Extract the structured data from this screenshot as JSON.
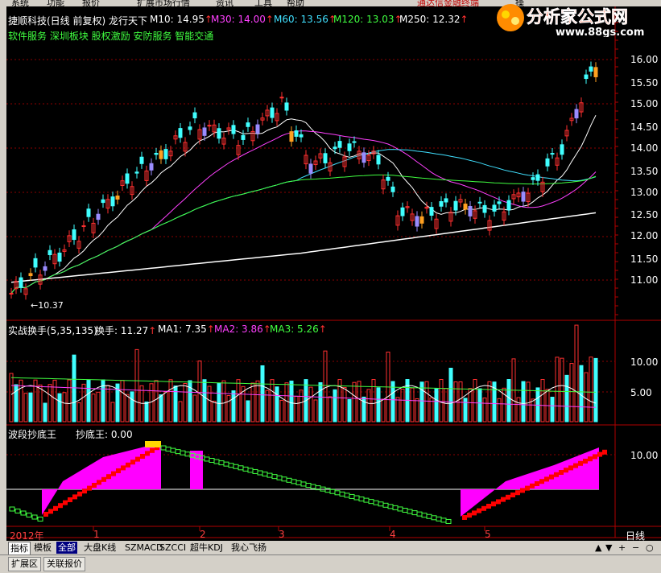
{
  "menu": [
    "系统",
    "功能",
    "报价",
    "扩展市场行情",
    "资讯",
    "工具",
    "帮助",
    "通达信金融终端",
    "操"
  ],
  "watermark": {
    "brand": "分析家公式网",
    "url": "www.88gs.com"
  },
  "main_chart": {
    "title": "捷顺科技(日线 前复权) 龙行天下",
    "ma_labels": [
      {
        "text": "M10: 14.95",
        "color": "#ffffff"
      },
      {
        "text": "M30: 14.00",
        "color": "#ff40ff"
      },
      {
        "text": "M60: 13.56",
        "color": "#40e0ff"
      },
      {
        "text": "M120: 13.03",
        "color": "#40ff40"
      },
      {
        "text": "M250: 12.32",
        "color": "#ffffff"
      }
    ],
    "concepts": "软件服务 深圳板块 股权激励 安防服务 智能交通",
    "low_marker": "←10.37",
    "y_ticks": [
      "16.00",
      "15.50",
      "15.00",
      "14.50",
      "14.00",
      "13.50",
      "13.00",
      "12.50",
      "12.00",
      "11.50",
      "11.00"
    ]
  },
  "turnover_panel": {
    "title": "实战换手(5,35,135)",
    "labels": [
      {
        "text": "换手: 11.27",
        "color": "#ffffff"
      },
      {
        "text": "MA1: 7.35",
        "color": "#ffffff"
      },
      {
        "text": "MA2: 3.86",
        "color": "#ff40ff"
      },
      {
        "text": "MA3: 5.26",
        "color": "#40ff40"
      }
    ],
    "y_ticks": [
      "10.00",
      "5.00"
    ]
  },
  "bottom_panel": {
    "title": "波段抄底王",
    "label": "抄底王: 0.00",
    "y_ticks": [
      "10.00"
    ]
  },
  "time_axis": {
    "labels": [
      "2012年",
      "1",
      "2",
      "3",
      "4",
      "5"
    ],
    "period": "日线"
  },
  "indicator_tabs": [
    "指标",
    "模板",
    "全部",
    "大盘K线",
    "SZMACD",
    "SZCCI",
    "超牛KDJ",
    "我心飞扬"
  ],
  "nav_glyphs": [
    "▲",
    "▼",
    "+",
    "−",
    "○"
  ],
  "bottom_tabs": [
    "扩展区",
    "关联报价"
  ],
  "colors": {
    "up": "#ff3030",
    "down": "#40ffff",
    "grid": "#8b0000",
    "axis": "#b00000",
    "highlight": "#ffa020",
    "violet": "#9a8cff"
  }
}
